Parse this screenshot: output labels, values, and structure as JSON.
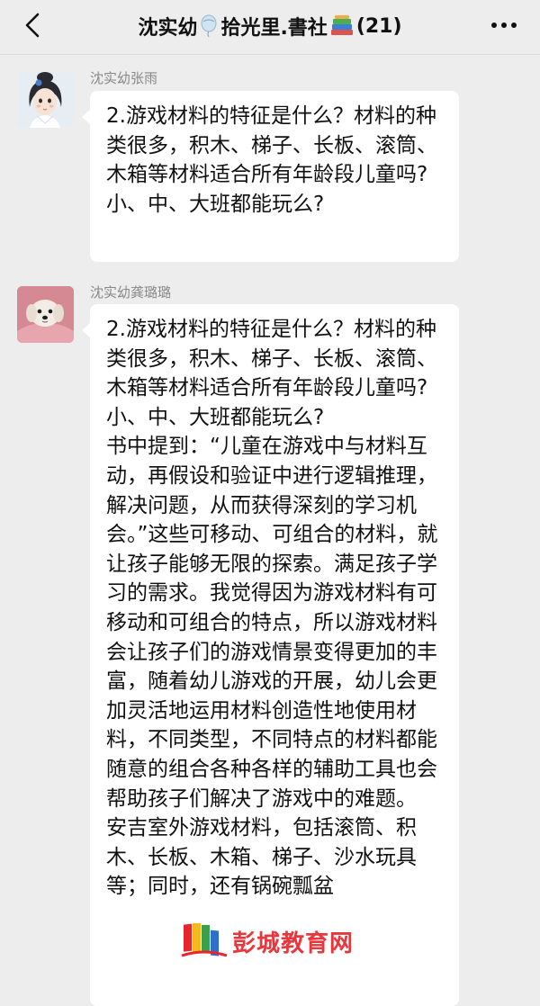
{
  "header": {
    "back_icon": "chevron-left-icon",
    "title_part1": "沈实幼",
    "title_emoji1": "balloon-icon",
    "title_part2": "拾光里.書社",
    "title_emoji2": "books-icon",
    "title_count": "(21)",
    "more_icon": "more-dots-icon"
  },
  "messages": [
    {
      "sender": "沈实幼张雨",
      "avatar": "illustrated-girl-avatar",
      "paragraphs": [
        "2.游戏材料的特征是什么？材料的种类很多，积木、梯子、长板、滚筒、木箱等材料适合所有年龄段儿童吗?小、中、大班都能玩么?"
      ]
    },
    {
      "sender": "沈实幼龚璐璐",
      "avatar": "puppy-avatar",
      "paragraphs": [
        "2.游戏材料的特征是什么？材料的种类很多，积木、梯子、长板、滚筒、木箱等材料适合所有年龄段儿童吗?小、中、大班都能玩么?",
        "书中提到：“儿童在游戏中与材料互动，再假设和验证中进行逻辑推理，解决问题，从而获得深刻的学习机会。”这些可移动、可组合的材料，就让孩子能够无限的探索。满足孩子学习的需求。我觉得因为游戏材料有可移动和可组合的特点，所以游戏材料会让孩子们的游戏情景变得更加的丰富，随着幼儿游戏的开展，幼儿会更加灵活地运用材料创造性地使用材料，不同类型，不同特点的材料都能随意的组合各种各样的辅助工具也会帮助孩子们解决了游戏中的难题。",
        "安吉室外游戏材料，包括滚筒、积木、长板、木箱、梯子、沙水玩具等；同时，还有锅碗瓢盆"
      ]
    }
  ],
  "watermark": {
    "text": "彭城教育网",
    "icon": "colorful-books-logo-icon"
  }
}
